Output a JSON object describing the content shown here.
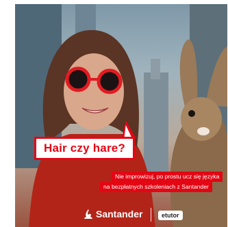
{
  "ad": {
    "speech_bubble": "Hair czy hare?",
    "caption_line1": "Nie improwizuj, po prostu ucz się języka",
    "caption_line2": "na bezpłatnych szkoleniach z Santander",
    "brand": "Santander",
    "partner": "etutor"
  },
  "colors": {
    "brand_red": "#e30613",
    "white": "#ffffff"
  }
}
